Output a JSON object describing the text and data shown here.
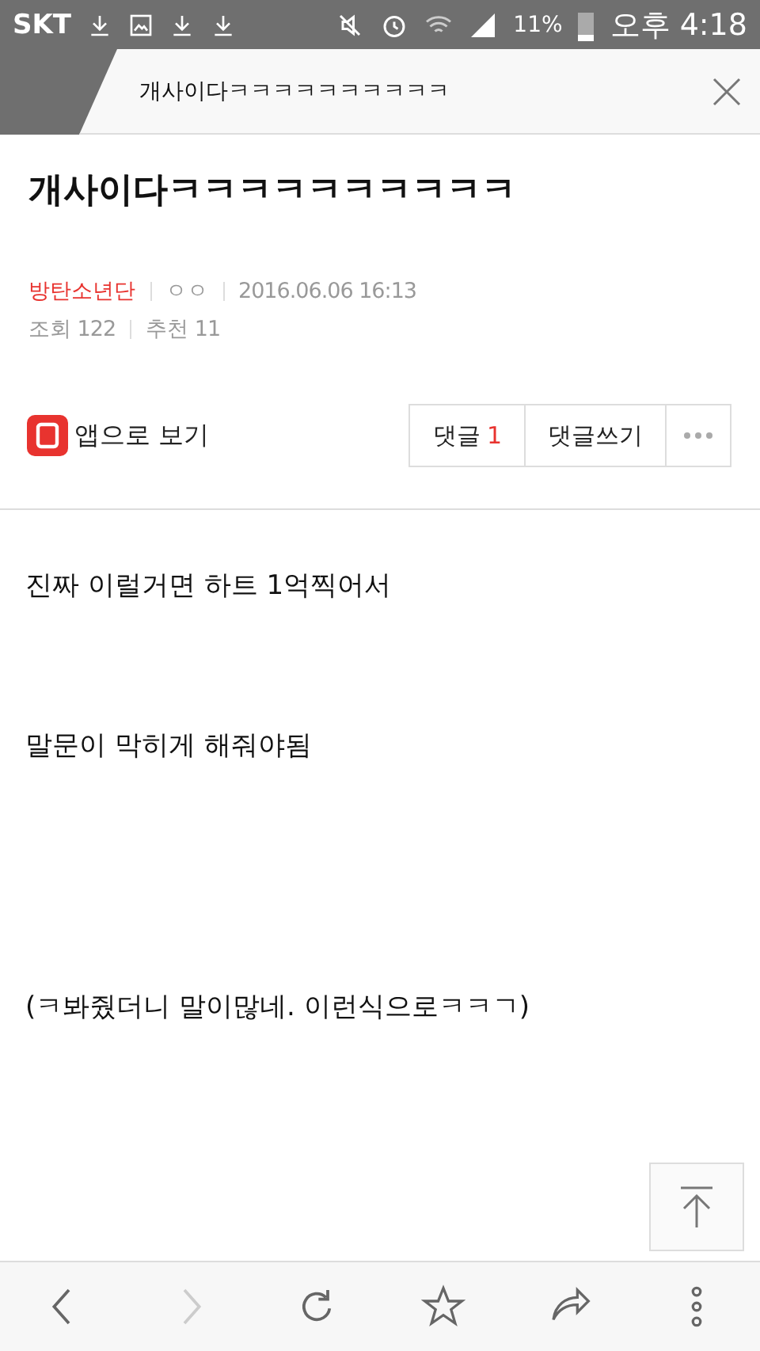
{
  "status_bar": {
    "carrier": "SKT",
    "battery": "11%",
    "time": "오후 4:18"
  },
  "tab": {
    "title": "개사이다ㅋㅋㅋㅋㅋㅋㅋㅋㅋㅋ"
  },
  "post": {
    "title": "개사이다ㅋㅋㅋㅋㅋㅋㅋㅋㅋㅋ",
    "author": "방탄소년단",
    "nickname": "ㅇㅇ",
    "date": "2016.06.06 16:13",
    "views": "조회 122",
    "likes": "추천 11"
  },
  "actions": {
    "app_link": "앱으로 보기",
    "comments_label": "댓글",
    "comments_count": "1",
    "write_comment": "댓글쓰기"
  },
  "body": [
    "진짜 이럴거면 하트 1억찍어서",
    "말문이 막히게 해줘야됨",
    "(ㅋ봐줬더니 말이많네. 이런식으로ㅋㅋㄱ)"
  ],
  "nav": [
    {
      "kind": "back",
      "disabled": false
    },
    {
      "kind": "forward",
      "disabled": true
    },
    {
      "kind": "reload",
      "disabled": false
    },
    {
      "kind": "bookmark",
      "disabled": false
    },
    {
      "kind": "share",
      "disabled": false
    },
    {
      "kind": "menu",
      "disabled": false
    }
  ]
}
